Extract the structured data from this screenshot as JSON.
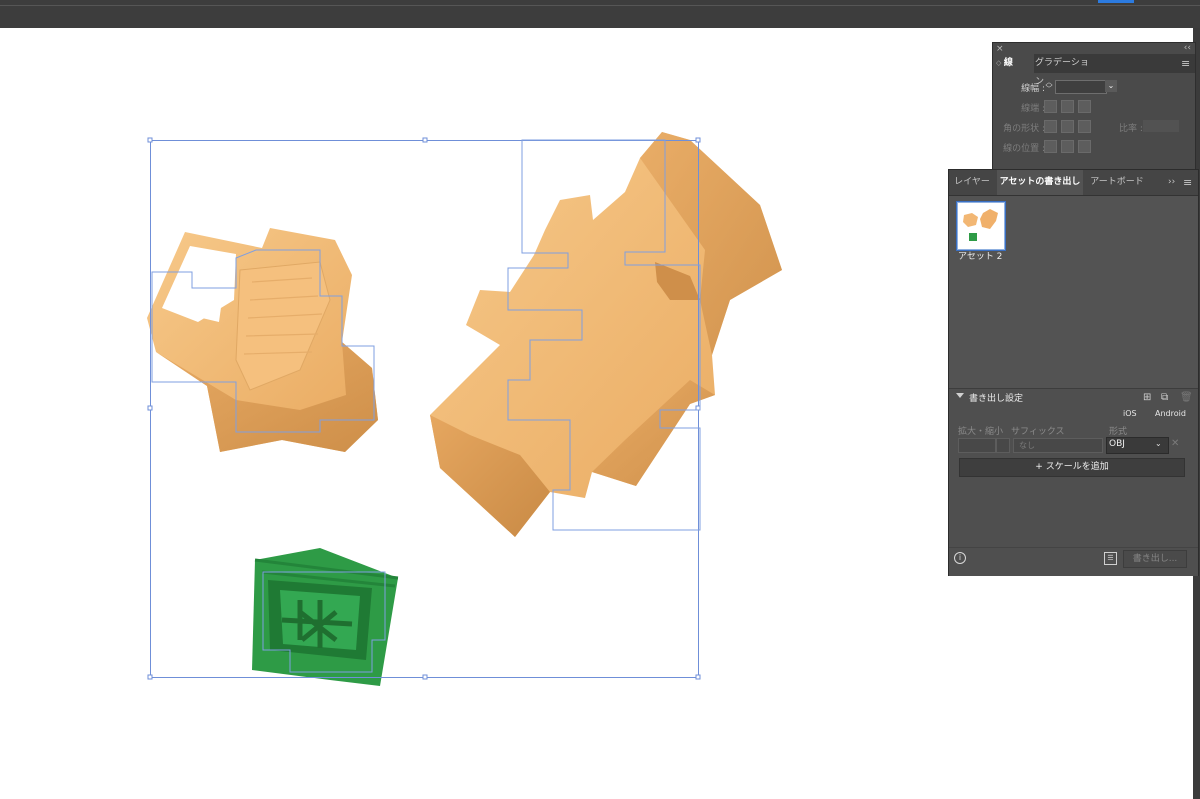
{
  "stroke_panel": {
    "close_glyph": "×",
    "collapse_glyph": "‹‹",
    "tabs": [
      {
        "label": "線",
        "active": true
      },
      {
        "label": "グラデーション",
        "active": false
      }
    ],
    "weight_label": "線幅 :",
    "cap_label": "線端 :",
    "corner_label": "角の形状 :",
    "ratio_label": "比率 :",
    "align_label": "線の位置 :",
    "menu_icon": "hamburger-menu-icon"
  },
  "asset_panel": {
    "tabs": [
      {
        "label": "レイヤー",
        "active": false
      },
      {
        "label": "アセットの書き出し",
        "active": true
      },
      {
        "label": "アートボード",
        "active": false
      }
    ],
    "more_glyph": "››",
    "asset_label": "アセット 2",
    "export_settings": {
      "title": "書き出し設定",
      "ios_label": "iOS",
      "android_label": "Android",
      "scale_label": "拡大・縮小",
      "suffix_label": "サフィックス",
      "format_label": "形式",
      "suffix_placeholder": "なし",
      "format_value": "OBJ",
      "add_scale_label": "スケールを追加"
    },
    "export_button": "書き出し..."
  },
  "colors": {
    "block_orange": "#f2b774",
    "kanji_green": "#2e9b46",
    "selection_blue": "#6f8fd8"
  }
}
